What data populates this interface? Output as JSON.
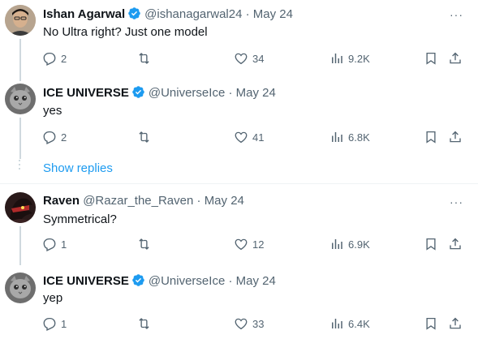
{
  "tweets": [
    {
      "name": "Ishan Agarwal",
      "verified": true,
      "handle": "@ishanagarwal24",
      "sep": "·",
      "date": "May 24",
      "text": "No Ultra right? Just one model",
      "replies": "2",
      "retweets": "",
      "likes": "34",
      "views": "9.2K"
    },
    {
      "name": "ICE UNIVERSE",
      "verified": true,
      "handle": "@UniverseIce",
      "sep": "·",
      "date": "May 24",
      "text": "yes",
      "replies": "2",
      "retweets": "",
      "likes": "41",
      "views": "6.8K"
    },
    {
      "name": "Raven",
      "verified": false,
      "handle": "@Razar_the_Raven",
      "sep": "·",
      "date": "May 24",
      "text": "Symmetrical?",
      "replies": "1",
      "retweets": "",
      "likes": "12",
      "views": "6.9K"
    },
    {
      "name": "ICE UNIVERSE",
      "verified": true,
      "handle": "@UniverseIce",
      "sep": "·",
      "date": "May 24",
      "text": "yep",
      "replies": "1",
      "retweets": "",
      "likes": "33",
      "views": "6.4K"
    }
  ],
  "show_replies_label": "Show replies",
  "more_icon": "···",
  "colors": {
    "accent": "#1d9bf0",
    "muted": "#536471",
    "text": "#0f1419",
    "thread_line": "#cfd9de"
  },
  "icons": [
    "reply-icon",
    "retweet-icon",
    "like-icon",
    "views-icon",
    "bookmark-icon",
    "share-icon",
    "verified-badge-icon",
    "more-icon"
  ]
}
